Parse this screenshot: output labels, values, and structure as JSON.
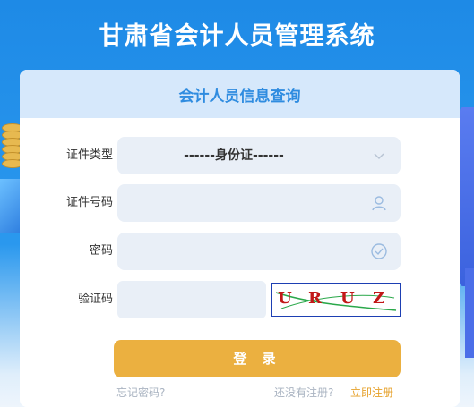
{
  "app": {
    "title": "甘肃省会计人员管理系统"
  },
  "card": {
    "title": "会计人员信息查询"
  },
  "form": {
    "id_type_label": "证件类型",
    "id_type_value": "------身份证------",
    "id_number_label": "证件号码",
    "id_number_value": "",
    "password_label": "密码",
    "password_value": "",
    "captcha_label": "验证码",
    "captcha_value": "",
    "captcha_text": [
      "U",
      "R",
      "U",
      "Z"
    ]
  },
  "actions": {
    "login_label": "登 录",
    "forgot_label": "忘记密码?",
    "no_account_label": "还没有注册?",
    "register_label": "立即注册"
  },
  "colors": {
    "background": "#1f8fe8",
    "accent": "#ebb040",
    "header": "#2f8ce0"
  },
  "icons": [
    "chevron-down-icon",
    "user-icon",
    "check-circle-icon"
  ]
}
